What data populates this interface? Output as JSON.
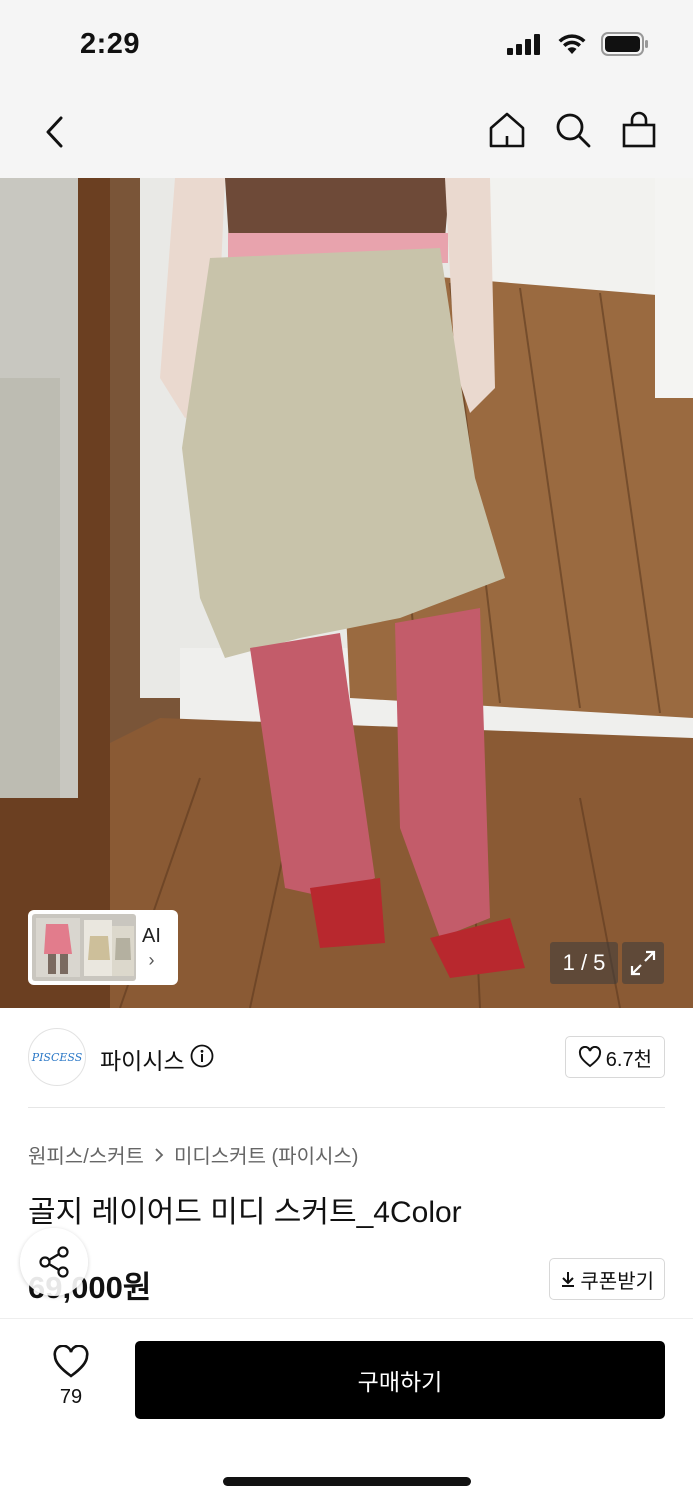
{
  "status_bar": {
    "time": "2:29"
  },
  "nav": {
    "back_icon": "chevron-left-icon",
    "home_icon": "home-icon",
    "search_icon": "search-icon",
    "bag_icon": "shopping-bag-icon"
  },
  "gallery": {
    "ai_label": "AI",
    "ai_chevron": "›",
    "counter": "1 / 5",
    "expand_icon": "expand-icon"
  },
  "brand": {
    "logo_text": "PISCESS",
    "name": "파이시스",
    "likes": "6.7천"
  },
  "product": {
    "breadcrumb": [
      "원피스/스커트",
      "미디스커트 (파이시스)"
    ],
    "title": "골지 레이어드 미디 스커트_4Color",
    "price": "69,000원",
    "coupon_label": "쿠폰받기"
  },
  "bottom": {
    "wish_count": "79",
    "buy_label": "구매하기"
  },
  "colors": {
    "buy_bg": "#000000",
    "brand_logo": "#2d79c7"
  }
}
